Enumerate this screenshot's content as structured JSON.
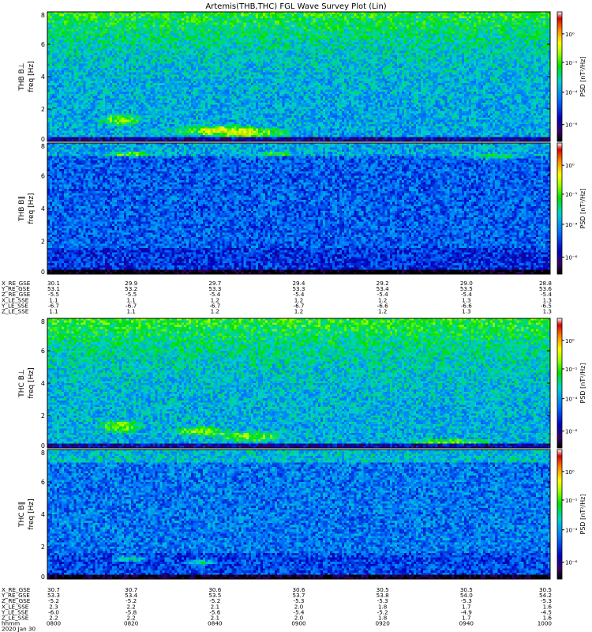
{
  "chart_data": {
    "type": "heatmap",
    "title": "Artemis(THB,THC) FGL Wave Survey Plot (Lin)",
    "colorbar": {
      "label": "PSD [nT²/Hz]",
      "tick_labels": [
        "10⁰",
        "10⁻¹",
        "10⁻⁴",
        "10⁻⁶"
      ],
      "colors": [
        "#ffffff",
        "#d70000",
        "#ff8800",
        "#ffff00",
        "#a0ff00",
        "#00e000",
        "#00d0d0",
        "#0070ff",
        "#0000c0",
        "#3a0060",
        "#000000"
      ]
    },
    "panels": [
      {
        "ylabel": "THB B⊥",
        "ylabel2": "freq [Hz]",
        "ylim": [
          0,
          8
        ],
        "yticks": [
          0,
          2,
          4,
          6,
          8
        ],
        "shows_colorbar_labels": true
      },
      {
        "ylabel": "THB B∥",
        "ylabel2": "freq [Hz]",
        "ylim": [
          0,
          8
        ],
        "yticks": [
          0,
          2,
          4,
          6,
          8
        ],
        "shows_colorbar_labels": true
      },
      {
        "ylabel": "THC B⊥",
        "ylabel2": "freq [Hz]",
        "ylim": [
          0,
          8
        ],
        "yticks": [
          0,
          2,
          4,
          6,
          8
        ],
        "shows_colorbar_labels": true
      },
      {
        "ylabel": "THC B∥",
        "ylabel2": "freq [Hz]",
        "ylim": [
          0,
          8
        ],
        "yticks": [
          0,
          2,
          4,
          6,
          8
        ],
        "shows_colorbar_labels": true
      }
    ],
    "ephemeris_blocks": [
      {
        "rows": [
          {
            "label": "X_RE_GSE",
            "values": [
              "30.1",
              "29.9",
              "29.7",
              "29.4",
              "29.2",
              "29.0",
              "28.8"
            ]
          },
          {
            "label": "Y_RE_GSE",
            "values": [
              "53.1",
              "53.2",
              "53.3",
              "53.3",
              "53.4",
              "53.5",
              "53.6"
            ]
          },
          {
            "label": "Z_RE_GSE",
            "values": [
              "-5.5",
              "-5.5",
              "-5.4",
              "-5.4",
              "-5.4",
              "-5.4",
              "-5.4"
            ]
          },
          {
            "label": "X_LE_SSE",
            "values": [
              "1.1",
              "1.1",
              "1.2",
              "1.2",
              "1.2",
              "1.3",
              "1.3"
            ]
          },
          {
            "label": "Y_LE_SSE",
            "values": [
              "-6.7",
              "-6.7",
              "-6.7",
              "-6.7",
              "-6.6",
              "-6.6",
              "-6.5"
            ]
          },
          {
            "label": "Z_LE_SSE",
            "values": [
              "1.1",
              "1.1",
              "1.2",
              "1.2",
              "1.2",
              "1.3",
              "1.3"
            ]
          }
        ]
      },
      {
        "rows": [
          {
            "label": "X_RE_GSE",
            "values": [
              "30.7",
              "30.7",
              "30.6",
              "30.6",
              "30.5",
              "30.5",
              "30.5"
            ]
          },
          {
            "label": "Y_RE_GSE",
            "values": [
              "53.3",
              "53.4",
              "53.5",
              "53.7",
              "53.8",
              "54.0",
              "54.2"
            ]
          },
          {
            "label": "Z_RE_GSE",
            "values": [
              "-5.2",
              "-5.2",
              "-5.2",
              "-5.3",
              "-5.3",
              "-5.3",
              "-5.3"
            ]
          },
          {
            "label": "X_LE_SSE",
            "values": [
              "2.3",
              "2.2",
              "2.1",
              "2.0",
              "1.8",
              "1.7",
              "1.6"
            ]
          },
          {
            "label": "Y_LE_SSE",
            "values": [
              "-6.0",
              "-5.8",
              "-5.6",
              "-5.4",
              "-5.2",
              "-4.9",
              "-4.5"
            ]
          },
          {
            "label": "Z_LE_SSE",
            "values": [
              "2.2",
              "2.2",
              "2.1",
              "2.0",
              "1.8",
              "1.7",
              "1.6"
            ]
          },
          {
            "label": "hhmm",
            "values": [
              "0800",
              "0820",
              "0840",
              "0900",
              "0920",
              "0940",
              "1000"
            ]
          },
          {
            "label": "2020 Jan 30",
            "values": []
          }
        ]
      }
    ]
  }
}
